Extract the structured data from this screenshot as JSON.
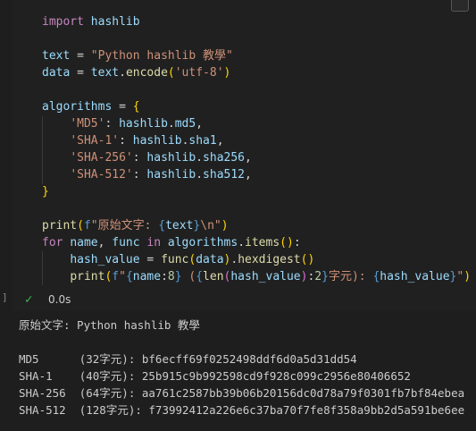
{
  "code_lines": [
    [
      [
        "kw",
        "import"
      ],
      [
        "plain",
        " "
      ],
      [
        "var",
        "hashlib"
      ]
    ],
    [],
    [
      [
        "var",
        "text"
      ],
      [
        "plain",
        " = "
      ],
      [
        "str",
        "\"Python hashlib 教學\""
      ]
    ],
    [
      [
        "var",
        "data"
      ],
      [
        "plain",
        " = "
      ],
      [
        "var",
        "text"
      ],
      [
        "plain",
        "."
      ],
      [
        "fn",
        "encode"
      ],
      [
        "br1",
        "("
      ],
      [
        "str",
        "'utf-8'"
      ],
      [
        "br1",
        ")"
      ]
    ],
    [],
    [
      [
        "var",
        "algorithms"
      ],
      [
        "plain",
        " = "
      ],
      [
        "br1",
        "{"
      ]
    ],
    [
      [
        "plain",
        "    "
      ],
      [
        "str",
        "'MD5'"
      ],
      [
        "plain",
        ": "
      ],
      [
        "var",
        "hashlib"
      ],
      [
        "plain",
        "."
      ],
      [
        "var",
        "md5"
      ],
      [
        "plain",
        ","
      ]
    ],
    [
      [
        "plain",
        "    "
      ],
      [
        "str",
        "'SHA-1'"
      ],
      [
        "plain",
        ": "
      ],
      [
        "var",
        "hashlib"
      ],
      [
        "plain",
        "."
      ],
      [
        "var",
        "sha1"
      ],
      [
        "plain",
        ","
      ]
    ],
    [
      [
        "plain",
        "    "
      ],
      [
        "str",
        "'SHA-256'"
      ],
      [
        "plain",
        ": "
      ],
      [
        "var",
        "hashlib"
      ],
      [
        "plain",
        "."
      ],
      [
        "var",
        "sha256"
      ],
      [
        "plain",
        ","
      ]
    ],
    [
      [
        "plain",
        "    "
      ],
      [
        "str",
        "'SHA-512'"
      ],
      [
        "plain",
        ": "
      ],
      [
        "var",
        "hashlib"
      ],
      [
        "plain",
        "."
      ],
      [
        "var",
        "sha512"
      ],
      [
        "plain",
        ","
      ]
    ],
    [
      [
        "br1",
        "}"
      ]
    ],
    [],
    [
      [
        "fn",
        "print"
      ],
      [
        "br1",
        "("
      ],
      [
        "kw2",
        "f"
      ],
      [
        "str",
        "\"原始文字: "
      ],
      [
        "kw2",
        "{"
      ],
      [
        "var",
        "text"
      ],
      [
        "kw2",
        "}"
      ],
      [
        "str",
        "\\n\""
      ],
      [
        "br1",
        ")"
      ]
    ],
    [
      [
        "kw",
        "for"
      ],
      [
        "plain",
        " "
      ],
      [
        "var",
        "name"
      ],
      [
        "plain",
        ", "
      ],
      [
        "var",
        "func"
      ],
      [
        "plain",
        " "
      ],
      [
        "kw",
        "in"
      ],
      [
        "plain",
        " "
      ],
      [
        "var",
        "algorithms"
      ],
      [
        "plain",
        "."
      ],
      [
        "fn",
        "items"
      ],
      [
        "br1",
        "()"
      ],
      [
        "plain",
        ":"
      ]
    ],
    [
      [
        "plain",
        "    "
      ],
      [
        "var",
        "hash_value"
      ],
      [
        "plain",
        " = "
      ],
      [
        "fn",
        "func"
      ],
      [
        "br1",
        "("
      ],
      [
        "var",
        "data"
      ],
      [
        "br1",
        ")"
      ],
      [
        "plain",
        "."
      ],
      [
        "fn",
        "hexdigest"
      ],
      [
        "br1",
        "()"
      ]
    ],
    [
      [
        "plain",
        "    "
      ],
      [
        "fn",
        "print"
      ],
      [
        "br1",
        "("
      ],
      [
        "kw2",
        "f"
      ],
      [
        "str",
        "\""
      ],
      [
        "kw2",
        "{"
      ],
      [
        "var",
        "name"
      ],
      [
        "plain",
        ":"
      ],
      [
        "num",
        "8"
      ],
      [
        "kw2",
        "}"
      ],
      [
        "str",
        " ("
      ],
      [
        "kw2",
        "{"
      ],
      [
        "fn",
        "len"
      ],
      [
        "br2",
        "("
      ],
      [
        "var",
        "hash_value"
      ],
      [
        "br2",
        ")"
      ],
      [
        "plain",
        ":"
      ],
      [
        "num",
        "2"
      ],
      [
        "kw2",
        "}"
      ],
      [
        "str",
        "字元): "
      ],
      [
        "kw2",
        "{"
      ],
      [
        "var",
        "hash_value"
      ],
      [
        "kw2",
        "}"
      ],
      [
        "str",
        "\""
      ],
      [
        "br1",
        ")"
      ]
    ]
  ],
  "status": {
    "check_icon": "check-icon",
    "time": "0.0s"
  },
  "output_lines": [
    "原始文字: Python hashlib 教學",
    "",
    "MD5      (32字元): bf6ecff69f0252498ddf6d0a5d31dd54",
    "SHA-1    (40字元): 25b915c9b992598cd9f928c099c2956e80406652",
    "SHA-256  (64字元): aa761c2587bb39b06b20156dc0d78a79f0301fb7bf84ebea",
    "SHA-512  (128字元): f73992412a226e6c37ba70f7fe8f358a9bb2d5a591be6ee"
  ],
  "colors": {
    "background": "#1e1e1e",
    "cell_background": "#202020",
    "success": "#3fb950"
  }
}
